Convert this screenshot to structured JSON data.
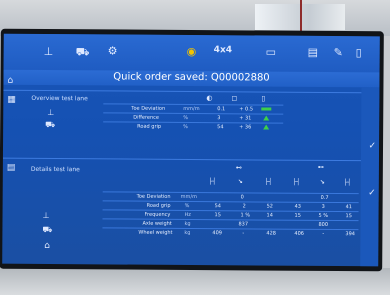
{
  "toolbar": {
    "mode_label": "4x4",
    "icons": [
      "car-icon",
      "settings-icon",
      "target-icon",
      "printer-icon",
      "monitor-icon",
      "edit-icon",
      "trash-icon"
    ]
  },
  "status_bar": {
    "message": "Quick order saved: Q00002880"
  },
  "overview": {
    "title": "Overview test lane",
    "rows": [
      {
        "label": "Toe Deviation",
        "unit": "mm/m",
        "v1": "0.1",
        "v2": "+ 0.5"
      },
      {
        "label": "Difference",
        "unit": "%",
        "v1": "3",
        "v2": "+ 31"
      },
      {
        "label": "Road grip",
        "unit": "%",
        "v1": "54",
        "v2": "+ 36"
      }
    ]
  },
  "detail": {
    "title": "Details test lane",
    "rows": [
      {
        "label": "Toe Deviation",
        "unit": "mm/m",
        "values": [
          "",
          "0",
          "",
          "",
          "0.7",
          ""
        ]
      },
      {
        "label": "Road grip",
        "unit": "%",
        "values": [
          "54",
          "2",
          "52",
          "43",
          "3",
          "41"
        ]
      },
      {
        "label": "Frequency",
        "unit": "Hz",
        "values": [
          "15",
          "1 %",
          "14",
          "15",
          "5 %",
          "15"
        ]
      },
      {
        "label": "Axle weight",
        "unit": "kg",
        "values": [
          "",
          "837",
          "",
          "",
          "800",
          ""
        ]
      },
      {
        "label": "Wheel weight",
        "unit": "kg",
        "values": [
          "409",
          "-",
          "428",
          "406",
          "-",
          "394"
        ]
      }
    ]
  }
}
